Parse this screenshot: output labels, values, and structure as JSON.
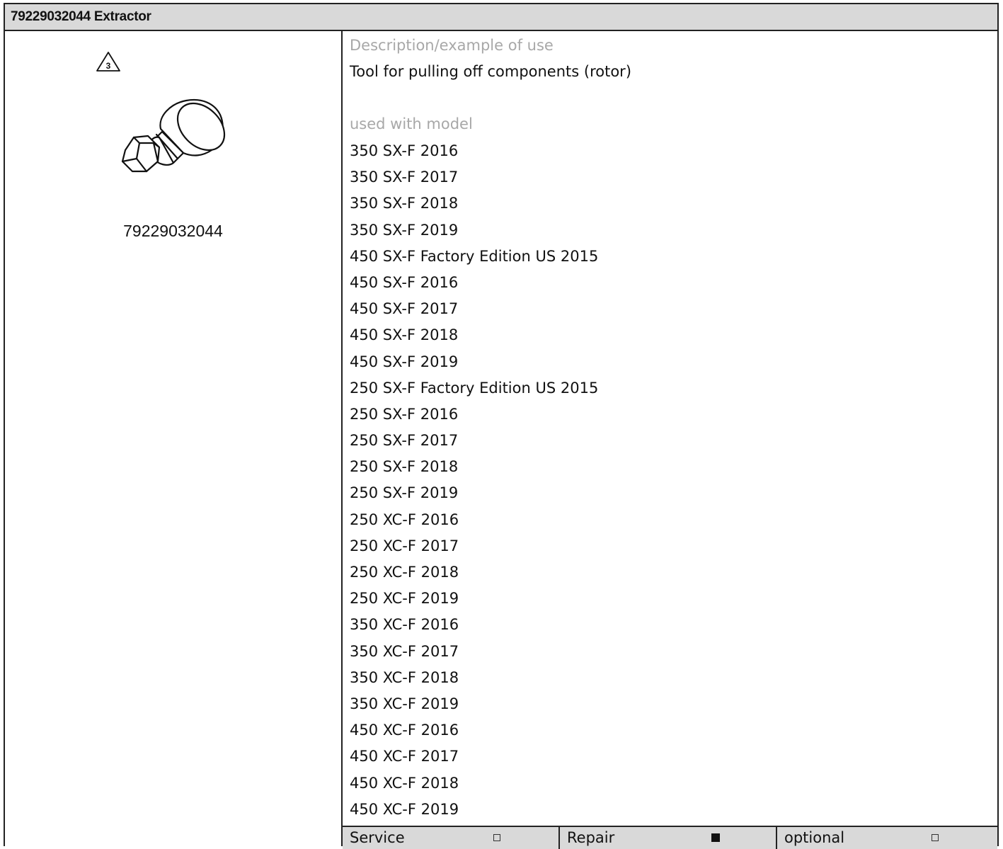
{
  "header": {
    "title": "79229032044 Extractor"
  },
  "left": {
    "warning_icon_number": "3",
    "tool_number": "79229032044"
  },
  "right": {
    "description_label": "Description/example of use",
    "description_text": "Tool for pulling off components (rotor)",
    "models_label": "used with model",
    "models": [
      "350 SX-F 2016",
      "350 SX-F 2017",
      "350 SX-F 2018",
      "350 SX-F 2019",
      "450 SX-F Factory Edition US 2015",
      "450 SX-F 2016",
      "450 SX-F 2017",
      "450 SX-F 2018",
      "450 SX-F 2019",
      "250 SX-F Factory Edition US 2015",
      "250 SX-F 2016",
      "250 SX-F 2017",
      "250 SX-F 2018",
      "250 SX-F 2019",
      "250 XC-F 2016",
      "250 XC-F 2017",
      "250 XC-F 2018",
      "250 XC-F 2019",
      "350 XC-F 2016",
      "350 XC-F 2017",
      "350 XC-F 2018",
      "350 XC-F 2019",
      "450 XC-F 2016",
      "450 XC-F 2017",
      "450 XC-F 2018",
      "450 XC-F 2019"
    ]
  },
  "footer": {
    "items": [
      {
        "label": "Service",
        "checked": false
      },
      {
        "label": "Repair",
        "checked": true
      },
      {
        "label": "optional",
        "checked": false
      }
    ]
  }
}
